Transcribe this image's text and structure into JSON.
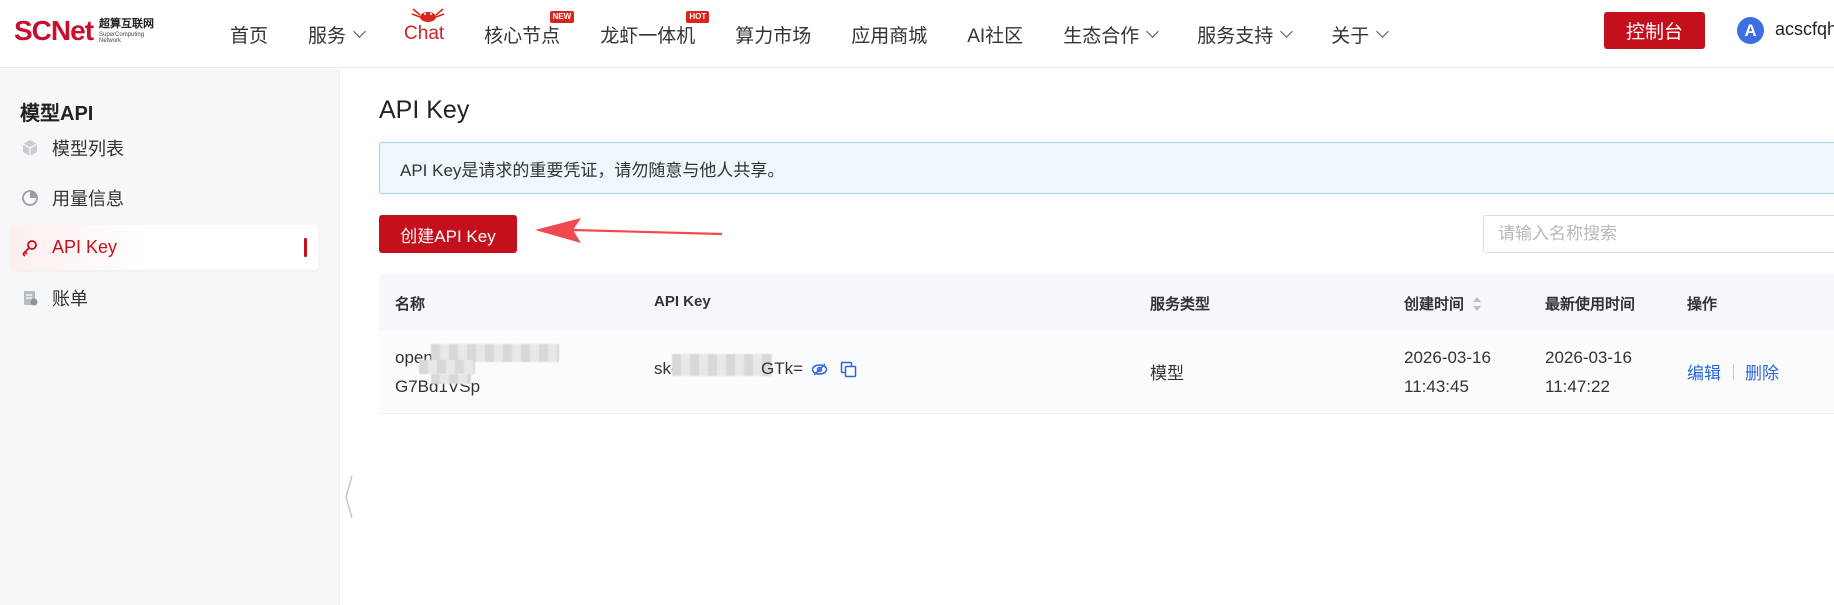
{
  "brand": {
    "logo_text_a": "SC",
    "logo_text_b": "Net",
    "cn_name": "超算互联网",
    "en_line1": "SuperComputing",
    "en_line2": "Network"
  },
  "nav": {
    "items": [
      {
        "label": "首页"
      },
      {
        "label": "服务"
      },
      {
        "label": "Chat"
      },
      {
        "label": "核心节点",
        "badge": "NEW"
      },
      {
        "label": "龙虾一体机",
        "badge": "HOT"
      },
      {
        "label": "算力市场"
      },
      {
        "label": "应用商城"
      },
      {
        "label": "AI社区"
      },
      {
        "label": "生态合作"
      },
      {
        "label": "服务支持"
      },
      {
        "label": "关于"
      }
    ],
    "console_label": "控制台",
    "avatar_letter": "A",
    "username": "acscfqh"
  },
  "sidebar": {
    "title": "模型API",
    "items": [
      {
        "label": "模型列表",
        "icon": "cube-icon"
      },
      {
        "label": "用量信息",
        "icon": "chart-icon"
      },
      {
        "label": "API Key",
        "icon": "key-icon",
        "active": true
      },
      {
        "label": "账单",
        "icon": "bill-icon"
      }
    ]
  },
  "main": {
    "title": "API Key",
    "notice": "API Key是请求的重要凭证，请勿随意与他人共享。",
    "create_label": "创建API Key",
    "search_placeholder": "请输入名称搜索",
    "table": {
      "headers": {
        "name": "名称",
        "key": "API Key",
        "type": "服务类型",
        "created": "创建时间",
        "last_used": "最新使用时间",
        "ops": "操作"
      },
      "rows": [
        {
          "name_line1": "open",
          "name_line2": "G7Bd1VSp",
          "key_prefix": "sk-A",
          "key_suffix": "GTk=",
          "type": "模型",
          "created_date": "2026-03-16",
          "created_time": "11:43:45",
          "last_date": "2026-03-16",
          "last_time": "11:47:22",
          "edit": "编辑",
          "delete": "删除"
        }
      ]
    }
  },
  "colors": {
    "brand_red": "#c4101d",
    "link_blue": "#2b65d9",
    "notice_bg": "#eef8fc"
  }
}
